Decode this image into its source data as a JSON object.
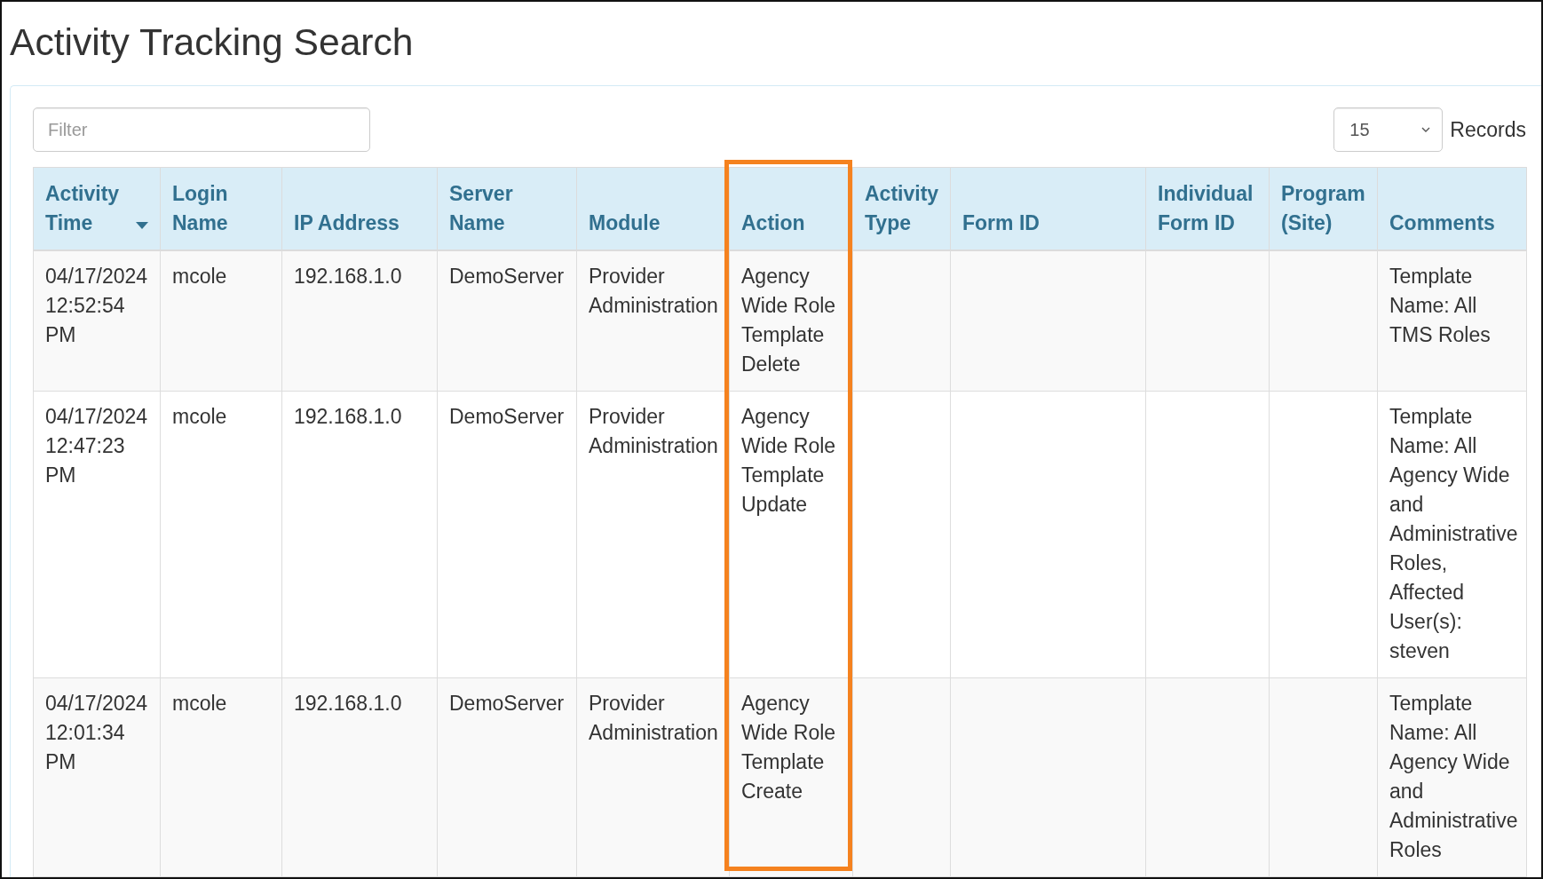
{
  "page": {
    "title": "Activity Tracking Search"
  },
  "toolbar": {
    "filter": {
      "placeholder": "Filter"
    },
    "records_per_page": {
      "value": "15",
      "label": "Records"
    }
  },
  "table": {
    "columns": [
      {
        "label": "Activity Time",
        "sorted": true,
        "highlighted": false
      },
      {
        "label": "Login Name",
        "sorted": false,
        "highlighted": false
      },
      {
        "label": "IP Address",
        "sorted": false,
        "highlighted": false
      },
      {
        "label": "Server Name",
        "sorted": false,
        "highlighted": false
      },
      {
        "label": "Module",
        "sorted": false,
        "highlighted": false
      },
      {
        "label": "Action",
        "sorted": false,
        "highlighted": true
      },
      {
        "label": "Activity Type",
        "sorted": false,
        "highlighted": false
      },
      {
        "label": "Form ID",
        "sorted": false,
        "highlighted": false
      },
      {
        "label": "Individual Form ID",
        "sorted": false,
        "highlighted": false
      },
      {
        "label": "Program (Site)",
        "sorted": false,
        "highlighted": false
      },
      {
        "label": "Comments",
        "sorted": false,
        "highlighted": false
      }
    ],
    "rows": [
      {
        "cells": [
          "04/17/2024 12:52:54 PM",
          "mcole",
          "192.168.1.0",
          "DemoServer",
          "Provider Administration",
          "Agency Wide Role Template Delete",
          null,
          null,
          null,
          null,
          "Template Name: All TMS Roles"
        ]
      },
      {
        "cells": [
          "04/17/2024 12:47:23 PM",
          "mcole",
          "192.168.1.0",
          "DemoServer",
          "Provider Administration",
          "Agency Wide Role Template Update",
          null,
          null,
          null,
          null,
          "Template Name: All Agency Wide and Administrative Roles, Affected User(s): steven"
        ]
      },
      {
        "cells": [
          "04/17/2024 12:01:34 PM",
          "mcole",
          "192.168.1.0",
          "DemoServer",
          "Provider Administration",
          "Agency Wide Role Template Create",
          null,
          null,
          null,
          null,
          "Template Name: All Agency Wide and Administrative Roles"
        ]
      }
    ]
  }
}
